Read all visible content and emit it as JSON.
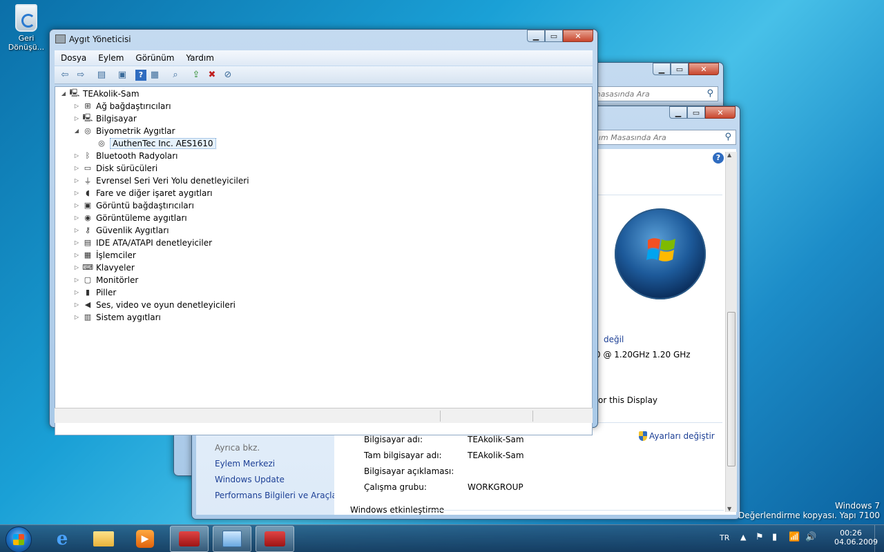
{
  "desktop": {
    "recycle_bin_label": "Geri Dönüşü...",
    "watermark_line1": "Windows 7",
    "watermark_line2": "Değerlendirme kopyası. Yapı 7100"
  },
  "device_manager": {
    "title": "Aygıt Yöneticisi",
    "menu": [
      "Dosya",
      "Eylem",
      "Görünüm",
      "Yardım"
    ],
    "root": "TEAkolik-Sam",
    "tree": [
      {
        "label": "Ağ bağdaştırıcıları",
        "icon": "network-adapter-icon",
        "expanded": false
      },
      {
        "label": "Bilgisayar",
        "icon": "computer-icon",
        "expanded": false
      },
      {
        "label": "Biyometrik Aygıtlar",
        "icon": "fingerprint-icon",
        "expanded": true
      },
      {
        "label": "AuthenTec Inc. AES1610",
        "icon": "fingerprint-icon",
        "child": true,
        "selected": true
      },
      {
        "label": "Bluetooth Radyoları",
        "icon": "bluetooth-icon",
        "expanded": false
      },
      {
        "label": "Disk sürücüleri",
        "icon": "disk-drive-icon",
        "expanded": false
      },
      {
        "label": "Evrensel Seri Veri Yolu denetleyicileri",
        "icon": "usb-icon",
        "expanded": false
      },
      {
        "label": "Fare ve diğer işaret aygıtları",
        "icon": "mouse-icon",
        "expanded": false
      },
      {
        "label": "Görüntü bağdaştırıcıları",
        "icon": "display-adapter-icon",
        "expanded": false
      },
      {
        "label": "Görüntüleme aygıtları",
        "icon": "camera-icon",
        "expanded": false
      },
      {
        "label": "Güvenlik Aygıtları",
        "icon": "key-icon",
        "expanded": false
      },
      {
        "label": "IDE ATA/ATAPI denetleyiciler",
        "icon": "ide-controller-icon",
        "expanded": false
      },
      {
        "label": "İşlemciler",
        "icon": "processor-icon",
        "expanded": false
      },
      {
        "label": "Klavyeler",
        "icon": "keyboard-icon",
        "expanded": false
      },
      {
        "label": "Monitörler",
        "icon": "monitor-icon",
        "expanded": false
      },
      {
        "label": "Piller",
        "icon": "battery-icon",
        "expanded": false
      },
      {
        "label": "Ses, video ve oyun denetleyicileri",
        "icon": "speaker-icon",
        "expanded": false
      },
      {
        "label": "Sistem aygıtları",
        "icon": "system-device-icon",
        "expanded": false
      }
    ]
  },
  "back_window": {
    "search_placeholder": "masasında Ara"
  },
  "system_window": {
    "search_placeholder": "ım Masasında Ara",
    "rating_link": "değil",
    "processor_text": "0  @ 1.20GHz   1.20 GHz",
    "pen_text": "or this Display",
    "see_also_label": "Ayrıca bkz.",
    "see_also_links": [
      "Eylem Merkezi",
      "Windows Update",
      "Performans Bilgileri ve Araçları"
    ],
    "settings": [
      {
        "label": "Bilgisayar adı:",
        "value": "TEAkolik-Sam"
      },
      {
        "label": "Tam bilgisayar adı:",
        "value": "TEAkolik-Sam"
      },
      {
        "label": "Bilgisayar açıklaması:",
        "value": ""
      },
      {
        "label": "Çalışma grubu:",
        "value": "WORKGROUP"
      }
    ],
    "change_settings_link": "Ayarları değiştir",
    "activation_heading": "Windows etkinleştirme"
  },
  "taskbar": {
    "language": "TR",
    "time": "00:26",
    "date": "04.06.2009"
  }
}
